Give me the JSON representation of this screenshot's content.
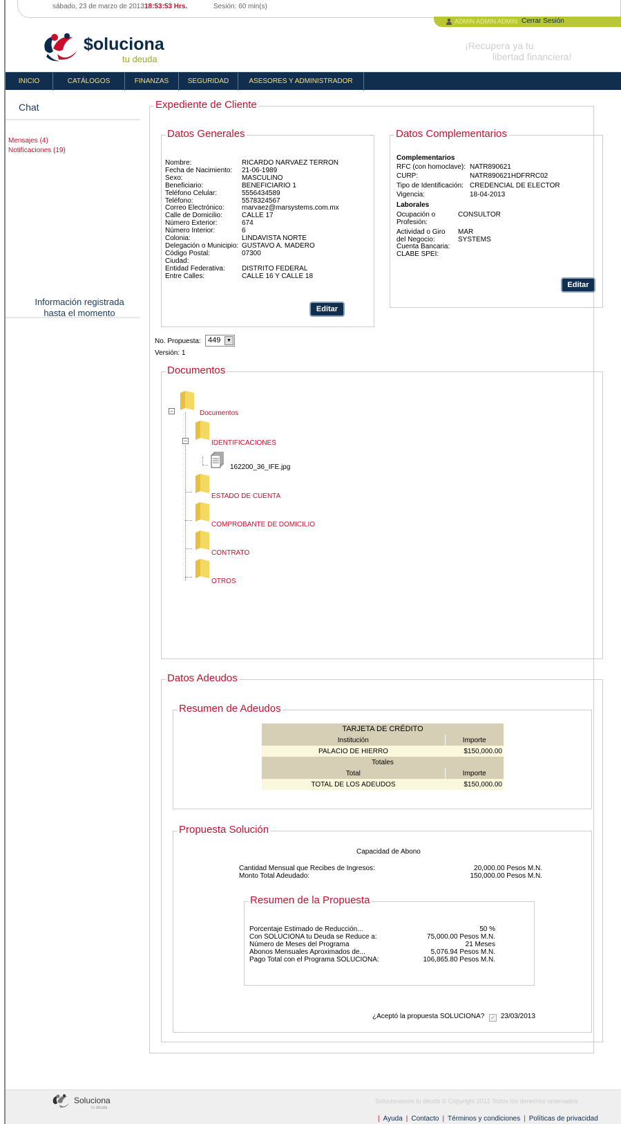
{
  "status": {
    "date": "sábado, 23 de marzo de 2013",
    "time": "18:53:53 Hrs.",
    "session": "Sesión: 60 min(s)"
  },
  "user": {
    "name": "ADMIN ADMIN ADMIN",
    "logout": "Cerrar Sesión"
  },
  "brand": {
    "name": "$oluciona",
    "sub": "tu deuda",
    "slogan1": "¡Recupera ya tu",
    "slogan2": "libertad financiera!"
  },
  "nav": [
    "INICIO",
    "CATÁLOGOS",
    "FINANZAS",
    "SEGURIDAD",
    "ASESORES Y ADMINISTRADOR"
  ],
  "sidebar": {
    "chat": "Chat",
    "messages": "Mensajes (4)",
    "notifications": "Notificaciones (19)",
    "info1": "Información registrada",
    "info2": "hasta el momento"
  },
  "expediente": {
    "title": "Expediente de Cliente",
    "generales": {
      "title": "Datos Generales",
      "rows": [
        {
          "k": "Nombre:",
          "v": "RICARDO NARVAEZ TERRON"
        },
        {
          "k": "Fecha de Nacimiento:",
          "v": "21-06-1989"
        },
        {
          "k": "Sexo:",
          "v": "MASCULINO"
        },
        {
          "k": "Beneficiario:",
          "v": "BENEFICIARIO 1"
        },
        {
          "k": "Teléfono Celular:",
          "v": "5556434589"
        },
        {
          "k": "Teléfono:",
          "v": "5578324567"
        },
        {
          "k": "Correo Electrónico:",
          "v": "rnarvaez@marsystems.com.mx"
        },
        {
          "k": "Calle de Domicilio:",
          "v": "CALLE 17"
        },
        {
          "k": "Número Exterior:",
          "v": "674"
        },
        {
          "k": "Número Interior:",
          "v": "6"
        },
        {
          "k": "Colonia:",
          "v": "LINDAVISTA NORTE"
        },
        {
          "k": "Delegación o Municipio:",
          "v": "GUSTAVO A. MADERO"
        },
        {
          "k": "Código Postal:",
          "v": "07300"
        },
        {
          "k": "Ciudad:",
          "v": ""
        },
        {
          "k": "Entidad Federativa:",
          "v": "DISTRITO FEDERAL"
        },
        {
          "k": "Entre Calles:",
          "v": "CALLE 16 Y CALLE 18"
        }
      ],
      "edit": "Editar"
    },
    "complementarios": {
      "title": "Datos Complementarios",
      "sec1": "Complementarios",
      "rows1": [
        {
          "k": "RFC (con homoclave):",
          "v": "NATR890621"
        },
        {
          "k": "CURP:",
          "v": "NATR890621HDFRRC02"
        },
        {
          "k": "Tipo de Identificación:",
          "v": "CREDENCIAL DE ELECTOR"
        },
        {
          "k": "Vigencia:",
          "v": "18-04-2013"
        }
      ],
      "sec2": "Laborales",
      "occ_k1": "Ocupación o",
      "occ_k2": "Profesión:",
      "occ_v": "CONSULTOR",
      "act_k1": "Actividad o Giro",
      "act_k2": "del Negocio:",
      "act_v1": "MAR",
      "act_v2": "SYSTEMS",
      "bank_k": "Cuenta Bancaria:",
      "clabe_k": "CLABE SPEI:",
      "edit": "Editar"
    },
    "propuesta_label": "No. Propuesta:",
    "propuesta_value": "449",
    "version": "Versión: 1"
  },
  "documentos": {
    "title": "Documentos",
    "root": "Documentos",
    "folders": [
      "IDENTIFICACIONES",
      "ESTADO DE CUENTA",
      "COMPROBANTE DE DOMICILIO",
      "CONTRATO",
      "OTROS"
    ],
    "file": "162200_36_IFE.jpg"
  },
  "adeudos": {
    "title": "Datos Adeudos",
    "resumen_title": "Resumen de Adeudos",
    "card_header": "TARJETA DE CRÉDITO",
    "col_inst": "Institución",
    "col_imp": "Importe",
    "inst": "PALACIO DE HIERRO",
    "inst_imp": "$150,000.00",
    "totales": "Totales",
    "col_total": "Total",
    "col_imp2": "Importe",
    "total_label": "TOTAL DE LOS ADEUDOS",
    "total_imp": "$150,000.00"
  },
  "propuesta": {
    "title": "Propuesta Solución",
    "capacidad": "Capacidad de Abono",
    "ingresos_k": "Cantidad Mensual que Recibes de Ingresos:",
    "ingresos_v": "20,000.00 Pesos M.N.",
    "adeudado_k": "Monto Total Adeudado:",
    "adeudado_v": "150,000.00 Pesos M.N.",
    "resumen_title": "Resumen de la Propuesta",
    "rows": [
      {
        "k": "Porcentaje Estimado de Reducción...",
        "v": "50 %"
      },
      {
        "k": "Con SOLUCIONA tu Deuda se Reduce a:",
        "v": "75,000.00 Pesos M.N."
      },
      {
        "k": "Número de Meses del Programa",
        "v": "21 Meses"
      },
      {
        "k": "Abonos Mensuales Aproximados de...",
        "v": "5,076.94 Pesos M.N."
      },
      {
        "k": "Pago Total con el Programa SOLUCIONA:",
        "v": "106,865.80 Pesos M.N."
      }
    ],
    "accept_q": "¿Aceptó la propuesta SOLUCIONA?",
    "accept_date": "23/03/2013"
  },
  "footer": {
    "brand": "Soluciona",
    "brand_sub": "tu deuda",
    "copyright": "Solucionamos tu deuda © Copyright 2012 Todos los derechos reservados",
    "links": [
      "Ayuda",
      "Contacto",
      "Términos y condiciones",
      "Políticas de privacidad"
    ]
  },
  "colors": {
    "accent": "#c8102e",
    "nav": "#112e4e",
    "lime": "#b9c832"
  }
}
